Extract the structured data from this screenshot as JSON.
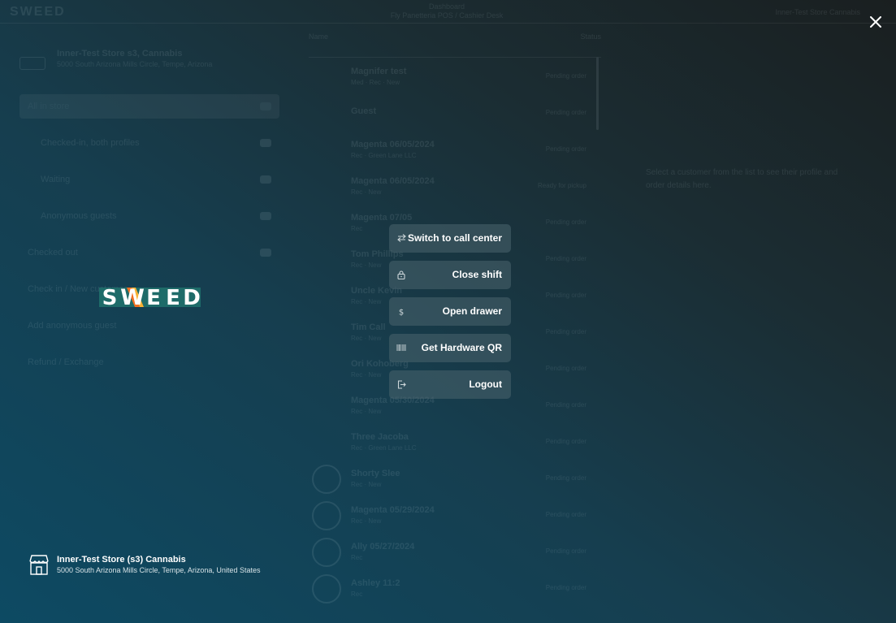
{
  "background": {
    "brand": "SWEED",
    "top_center_line1": "Dashboard",
    "top_center_line2": "Fly Panetteria POS / Cashier Desk",
    "top_right": "Inner-Test Store Cannabis",
    "sidebar_title": "Inner-Test Store s3, Cannabis",
    "sidebar_subtitle": "5000 South Arizona Mills Circle, Tempe, Arizona",
    "nav_items": [
      {
        "label": "All in store",
        "active": true,
        "sub": false
      },
      {
        "label": "Checked-in, both profiles",
        "active": false,
        "sub": true
      },
      {
        "label": "Waiting",
        "active": false,
        "sub": true
      },
      {
        "label": "Anonymous guests",
        "active": false,
        "sub": true
      },
      {
        "label": "Checked out",
        "active": false,
        "sub": false
      },
      {
        "label": "Check in / New customer",
        "active": false,
        "sub": false
      },
      {
        "label": "Add anonymous guest",
        "active": false,
        "sub": false
      },
      {
        "label": "Refund / Exchange",
        "active": false,
        "sub": false
      }
    ],
    "list_head_left": "Name",
    "list_head_right": "Status",
    "rows": [
      {
        "name": "Magnifer test",
        "meta": "Med · Rec · New",
        "right": "Pending order"
      },
      {
        "name": "Guest",
        "meta": "",
        "right": "Pending order"
      },
      {
        "name": "Magenta 06/05/2024",
        "meta": "Rec · Green Lane LLC",
        "right": "Pending order"
      },
      {
        "name": "Magenta 06/05/2024",
        "meta": "Rec · New",
        "right": "Ready for pickup"
      },
      {
        "name": "Magenta 07/05",
        "meta": "Rec",
        "right": "Pending order"
      },
      {
        "name": "Tom Phillips",
        "meta": "Rec · New",
        "right": "Pending order"
      },
      {
        "name": "Uncle Kevin",
        "meta": "Rec · New",
        "right": "Pending order"
      },
      {
        "name": "Tim Call",
        "meta": "Rec · New",
        "right": "Pending order"
      },
      {
        "name": "Ori Kohoberg",
        "meta": "Rec · New",
        "right": "Pending order"
      },
      {
        "name": "Magenta 05/30/2024",
        "meta": "Rec · New",
        "right": "Pending order"
      },
      {
        "name": "Three Jacoba",
        "meta": "Rec · Green Lane LLC",
        "right": "Pending order"
      },
      {
        "name": "Shorty Slee",
        "meta": "Rec · New",
        "right": "Pending order"
      },
      {
        "name": "Magenta 05/29/2024",
        "meta": "Rec · New",
        "right": "Pending order"
      },
      {
        "name": "Ally 05/27/2024",
        "meta": "Rec",
        "right": "Pending order"
      },
      {
        "name": "Ashley 11:2",
        "meta": "Rec",
        "right": "Pending order"
      }
    ],
    "detail_text": "Select a customer from the list to see their profile and order details here."
  },
  "close_button": {
    "icon": "close-icon"
  },
  "logo": {
    "letters": [
      "S",
      "W",
      "E",
      "E",
      "D"
    ],
    "colors": {
      "panel": "#1e6b69",
      "letter": "#ffffff",
      "stripe_orange": "#f26f21",
      "stripe_yellow": "#f9b233"
    }
  },
  "menu": [
    {
      "id": "switch-to-call-center",
      "label": "Switch to call center",
      "icon": "swap-arrows-icon"
    },
    {
      "id": "close-shift",
      "label": "Close shift",
      "icon": "lock-icon"
    },
    {
      "id": "open-drawer",
      "label": "Open drawer",
      "icon": "dollar-icon"
    },
    {
      "id": "get-hardware-qr",
      "label": "Get Hardware QR",
      "icon": "barcode-icon"
    },
    {
      "id": "logout",
      "label": "Logout",
      "icon": "logout-icon"
    }
  ],
  "store": {
    "icon": "storefront-icon",
    "name": "Inner-Test Store (s3) Cannabis",
    "address": "5000 South Arizona Mills Circle, Tempe, Arizona, United States"
  },
  "colors": {
    "overlay_gradient_start": "#0d4a63",
    "overlay_gradient_end": "#1a1f20",
    "menu_button_bg": "#4a646e",
    "text": "#ffffff"
  }
}
